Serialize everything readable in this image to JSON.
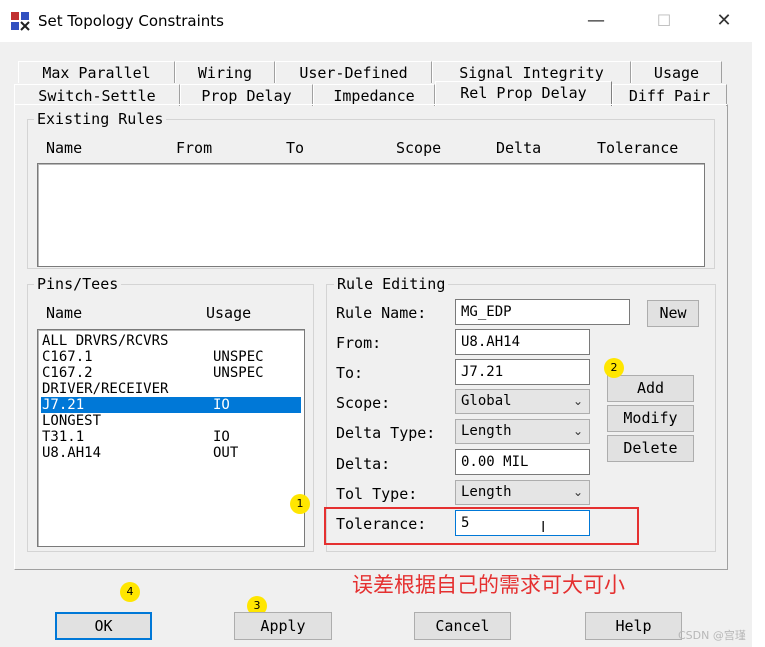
{
  "window": {
    "title": "Set Topology Constraints",
    "minimize": "—",
    "maximize": "☐",
    "close": "✕"
  },
  "tabs_row1": [
    "Max Parallel",
    "Wiring",
    "User-Defined",
    "Signal Integrity",
    "Usage"
  ],
  "tabs_row2": [
    "Switch-Settle",
    "Prop Delay",
    "Impedance",
    "Rel Prop Delay",
    "Diff Pair"
  ],
  "selected_tab": "Rel Prop Delay",
  "existing_rules": {
    "legend": "Existing Rules",
    "columns": [
      "Name",
      "From",
      "To",
      "Scope",
      "Delta",
      "Tolerance"
    ]
  },
  "pins_tees": {
    "legend": "Pins/Tees",
    "col_name": "Name",
    "col_usage": "Usage",
    "items": [
      {
        "name": "ALL DRVRS/RCVRS",
        "usage": ""
      },
      {
        "name": "C167.1",
        "usage": "UNSPEC"
      },
      {
        "name": "C167.2",
        "usage": "UNSPEC"
      },
      {
        "name": "DRIVER/RECEIVER",
        "usage": ""
      },
      {
        "name": "J7.21",
        "usage": "IO",
        "selected": true
      },
      {
        "name": "LONGEST",
        "usage": ""
      },
      {
        "name": "T31.1",
        "usage": "IO"
      },
      {
        "name": "U8.AH14",
        "usage": "OUT"
      }
    ]
  },
  "rule_editing": {
    "legend": "Rule Editing",
    "rule_name_label": "Rule Name:",
    "rule_name": "MG_EDP",
    "from_label": "From:",
    "from": "U8.AH14",
    "to_label": "To:",
    "to": "J7.21",
    "scope_label": "Scope:",
    "scope": "Global",
    "delta_type_label": "Delta Type:",
    "delta_type": "Length",
    "delta_label": "Delta:",
    "delta": "0.00 MIL",
    "tol_type_label": "Tol Type:",
    "tol_type": "Length",
    "tolerance_label": "Tolerance:",
    "tolerance": "5",
    "new_button": "New",
    "add_button": "Add",
    "modify_button": "Modify",
    "delete_button": "Delete"
  },
  "footer": {
    "ok": "OK",
    "apply": "Apply",
    "cancel": "Cancel",
    "help": "Help"
  },
  "annotations": {
    "badge1": "1",
    "badge2": "2",
    "badge3": "3",
    "badge4": "4",
    "note": "误差根据自己的需求可大可小",
    "watermark": "CSDN @宫瑾"
  },
  "colors": {
    "selection": "#0078d7",
    "annotation_red": "#e53030",
    "badge_yellow": "#ffe600"
  }
}
